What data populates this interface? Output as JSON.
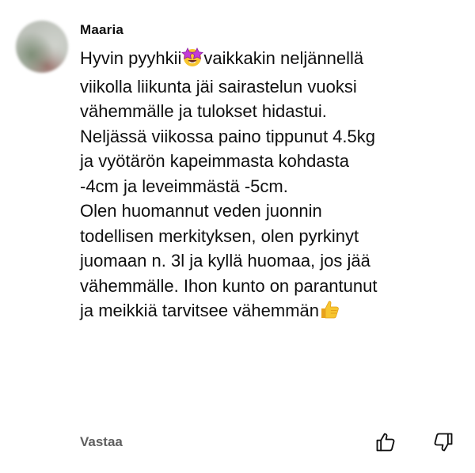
{
  "comment": {
    "author": "Maaria",
    "lines": [
      {
        "before": "Hyvin pyyhkii",
        "emoji": "star-struck-emoji",
        "after": "vaikkakin neljännellä"
      },
      {
        "text": "viikolla liikunta jäi sairastelun vuoksi"
      },
      {
        "text": "vähemmälle ja tulokset hidastui."
      },
      {
        "text": "Neljässä viikossa paino tippunut 4.5kg"
      },
      {
        "text": "ja vyötärön kapeimmasta kohdasta"
      },
      {
        "text": "-4cm ja leveimmästä -5cm."
      },
      {
        "text": "Olen huomannut veden juonnin"
      },
      {
        "text": "todellisen merkityksen, olen pyrkinyt"
      },
      {
        "text": "juomaan n. 3l ja kyllä huomaa, jos jää"
      },
      {
        "text": "vähemmälle. Ihon kunto on parantunut"
      },
      {
        "before": "ja meikkiä tarvitsee vähemmän",
        "emoji": "thumbs-up-emoji"
      }
    ],
    "reply_label": "Vastaa",
    "icons": {
      "like": "thumbs-up-outline-icon",
      "dislike": "thumbs-down-outline-icon"
    }
  },
  "colors": {
    "text": "#0f0f0f",
    "secondary_text": "#606060",
    "background": "#ffffff"
  }
}
